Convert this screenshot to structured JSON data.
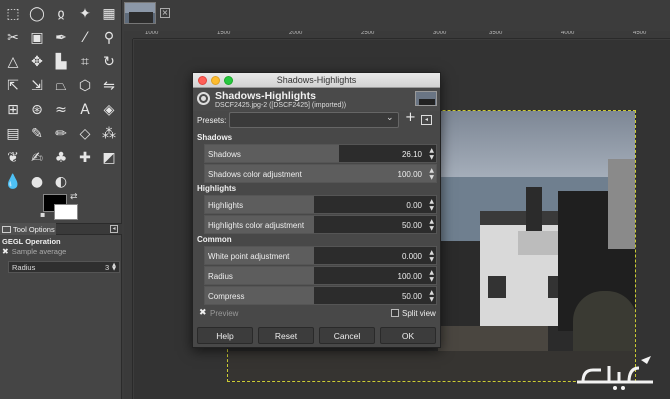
{
  "canvas": {
    "ruler_labels": [
      "1000",
      "1500",
      "2000",
      "2500",
      "3000",
      "3500",
      "4000",
      "4500"
    ]
  },
  "tool_options": {
    "tab_label": "Tool Options",
    "operation_title": "GEGL Operation",
    "sample_average_label": "Sample average",
    "radius_label": "Radius",
    "radius_value": "3"
  },
  "dialog": {
    "window_title": "Shadows-Highlights",
    "heading": "Shadows-Highlights",
    "subheading": "DSCF2425.jpg-2 ([DSCF2425] (imported))",
    "presets_label": "Presets:",
    "sections": {
      "shadows": "Shadows",
      "highlights": "Highlights",
      "common": "Common"
    },
    "sliders": [
      {
        "label": "Shadows",
        "value": "26.10",
        "fraction": 0.58
      },
      {
        "label": "Shadows color adjustment",
        "value": "100.00",
        "fraction": 1.0
      },
      {
        "label": "Highlights",
        "value": "0.00",
        "fraction": 0.47
      },
      {
        "label": "Highlights color adjustment",
        "value": "50.00",
        "fraction": 0.47
      },
      {
        "label": "White point adjustment",
        "value": "0.000",
        "fraction": 0.47
      },
      {
        "label": "Radius",
        "value": "100.00",
        "fraction": 0.47
      },
      {
        "label": "Compress",
        "value": "50.00",
        "fraction": 0.47
      }
    ],
    "preview_label": "Preview",
    "preview_checked": true,
    "split_view_label": "Split view",
    "split_view_checked": false,
    "buttons": {
      "help": "Help",
      "reset": "Reset",
      "cancel": "Cancel",
      "ok": "OK"
    }
  },
  "colors": {
    "foreground": "#000000",
    "background": "#ffffff",
    "close_button": "#ff5f57",
    "minimize_button": "#febc2e",
    "zoom_button": "#28c840",
    "watermark": "#f2f2f2"
  },
  "watermark": {
    "text": "سِتاد نیوز"
  }
}
